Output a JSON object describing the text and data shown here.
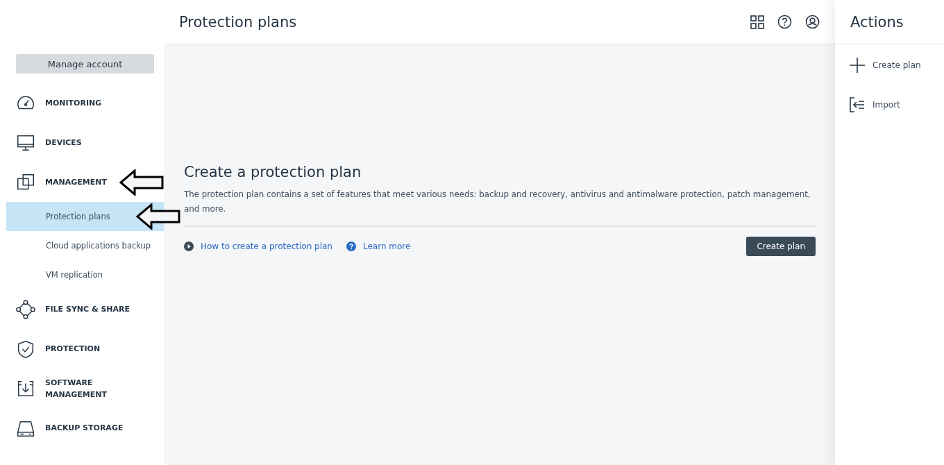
{
  "header": {
    "title": "Protection plans"
  },
  "sidebar": {
    "account_button": "Manage account",
    "items": [
      {
        "label": "MONITORING",
        "pointed": false
      },
      {
        "label": "DEVICES",
        "pointed": false
      },
      {
        "label": "MANAGEMENT",
        "pointed": true,
        "children": [
          {
            "label": "Protection plans",
            "selected": true,
            "pointed": true
          },
          {
            "label": "Cloud applications backup",
            "selected": false,
            "pointed": false
          },
          {
            "label": "VM replication",
            "selected": false,
            "pointed": false
          }
        ]
      },
      {
        "label": "FILE SYNC & SHARE",
        "pointed": false
      },
      {
        "label": "PROTECTION",
        "pointed": false
      },
      {
        "label": "SOFTWARE MANAGEMENT",
        "pointed": false
      },
      {
        "label": "BACKUP STORAGE",
        "pointed": false
      }
    ]
  },
  "empty_state": {
    "title": "Create a protection plan",
    "description": "The protection plan contains a set of features that meet various needs: backup and recovery, antivirus and antimalware protection, patch management, and more.",
    "links": [
      {
        "label": "How to create a protection plan",
        "kind": "video"
      },
      {
        "label": "Learn more",
        "kind": "help"
      }
    ],
    "button": "Create plan"
  },
  "actions": {
    "title": "Actions",
    "items": [
      {
        "label": "Create plan",
        "kind": "add"
      },
      {
        "label": "Import",
        "kind": "import"
      }
    ]
  }
}
